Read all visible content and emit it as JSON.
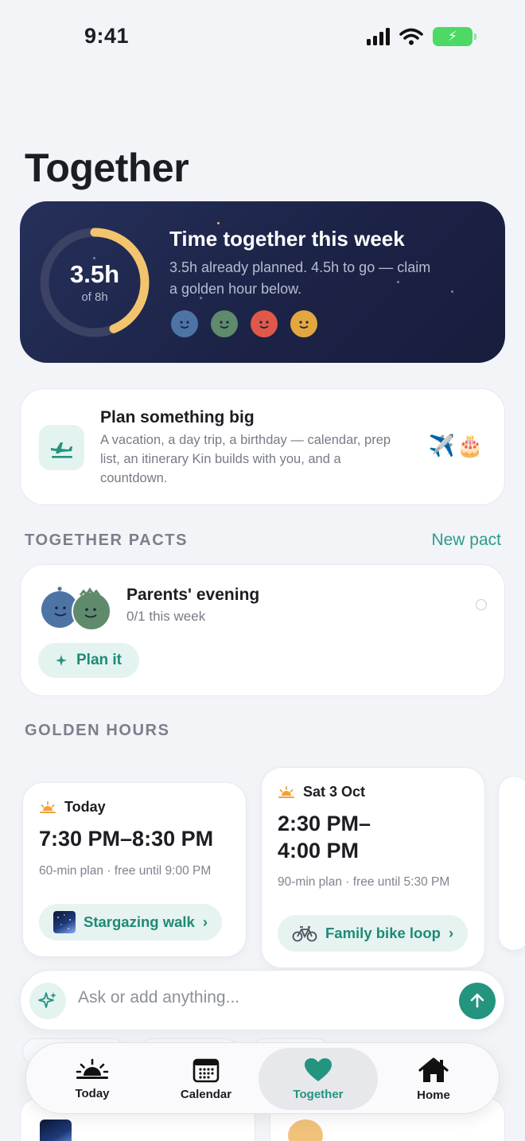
{
  "status_bar": {
    "time": "9:41"
  },
  "page": {
    "title": "Together"
  },
  "hero": {
    "ring_value": "3.5h",
    "ring_sub": "of 8h",
    "progress": 0.4375,
    "title": "Time together this week",
    "description": "3.5h already planned. 4.5h to go — claim a golden hour below.",
    "avatar_colors": [
      "#4e74a6",
      "#5f8a6c",
      "#e0584a",
      "#e3a73f"
    ],
    "ring_color": "#f2c46d"
  },
  "big_plan": {
    "title": "Plan something big",
    "description": "A vacation, a day trip, a birthday — calendar, prep list, an itinerary Kin builds with you, and a countdown.",
    "emoji": "✈️🎂"
  },
  "pacts": {
    "section_label": "TOGETHER PACTS",
    "new_link": "New pact",
    "items": [
      {
        "title": "Parents' evening",
        "progress_text": "0/1 this week",
        "action_label": "Plan it"
      }
    ]
  },
  "golden_hours": {
    "section_label": "GOLDEN HOURS",
    "items": [
      {
        "day": "Today",
        "time": "7:30 PM–8:30 PM",
        "note": "60-min plan · free until 9:00 PM",
        "activity": "Stargazing walk"
      },
      {
        "day": "Sat 3 Oct",
        "time_line1": "2:30 PM–",
        "time_line2": "4:00 PM",
        "note": "90-min plan · free until 5:30 PM",
        "activity": "Family bike loop"
      }
    ]
  },
  "ask": {
    "placeholder": "Ask or add anything..."
  },
  "tabs": [
    {
      "label": "Today",
      "icon": "sunrise-icon"
    },
    {
      "label": "Calendar",
      "icon": "calendar-icon"
    },
    {
      "label": "Together",
      "icon": "heart-icon",
      "active": true
    },
    {
      "label": "Home",
      "icon": "house-icon"
    }
  ],
  "colors": {
    "accent": "#23947e",
    "hero_bg": "#1c2347"
  }
}
